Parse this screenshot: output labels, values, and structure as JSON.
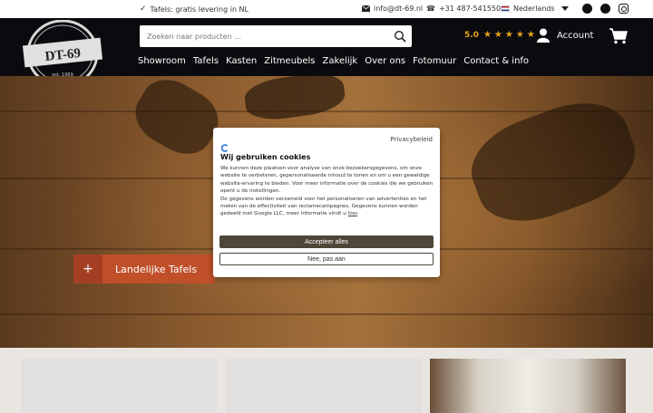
{
  "topbar": {
    "shipping": "Tafels: gratis levering in NL",
    "email": "info@dt-69.nl",
    "phone": "+31 487-541550",
    "language": "Nederlands",
    "social": [
      "facebook-icon",
      "pinterest-icon",
      "instagram-icon"
    ]
  },
  "header": {
    "logo_text": "DT-69",
    "logo_est": "est. 1969",
    "search_placeholder": "Zoeken naar producten ...",
    "rating_score": "5.0",
    "rating_stars": 5,
    "account_label": "Account",
    "nav": [
      "Showroom",
      "Tafels",
      "Kasten",
      "Zitmeubels",
      "Zakelijk",
      "Over ons",
      "Fotomuur",
      "Contact & info"
    ]
  },
  "hero": {
    "cta_label": "Landelijke Tafels",
    "cta_icon": "+"
  },
  "cookie": {
    "privacy_link": "Privacybeleid",
    "title": "Wij gebruiken cookies",
    "body_1": "We kunnen deze plaatsen voor analyse van onze bezoekersgegevens, om onze website te verbeteren, gepersonaliseerde inhoud te tonen en om u een geweldige website-ervaring te bieden. Voor meer informatie over de cookies die we gebruiken opent u de instellingen.",
    "body_2": "De gegevens worden verzameld voor het personaliseren van advertenties en het meten van de effectiviteit van reclamecampagnes. Gegevens kunnen worden gedeeld met Google LLC, meer informatie vindt u",
    "body_link": "hier",
    "accept_label": "Accepteer alles",
    "reject_label": "Nee, pas aan"
  },
  "colors": {
    "header_bg": "#0b0b0f",
    "accent": "#c0502a",
    "accept_btn": "#4d4639",
    "star": "#e8a317"
  }
}
